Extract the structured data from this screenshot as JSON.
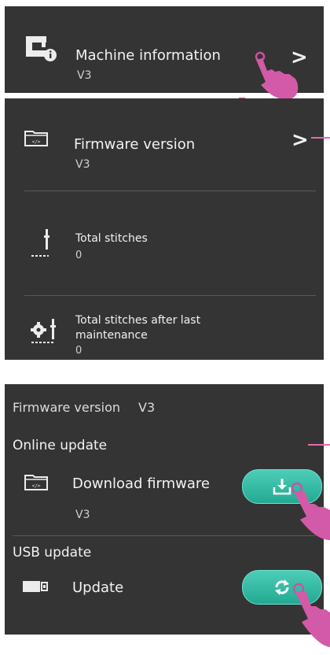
{
  "machine_info": {
    "title": "Machine information",
    "value": "V3"
  },
  "details": {
    "firmware": {
      "title": "Firmware version",
      "value": "V3"
    },
    "total_stitches": {
      "title": "Total stitches",
      "value": "0"
    },
    "after_maintenance": {
      "title_line1": "Total stitches after last",
      "title_line2": "maintenance",
      "value": "0"
    }
  },
  "firmware_screen": {
    "header": "Firmware version",
    "header_value": "V3",
    "online_update": "Online update",
    "download_label": "Download firmware",
    "download_version": "V3",
    "usb_update": "USB update",
    "update_label": "Update"
  },
  "colors": {
    "panel": "#343434",
    "accent_pink": "#e26ab0",
    "button_teal": "#2fbca5",
    "arrow": "#e83e8c"
  }
}
